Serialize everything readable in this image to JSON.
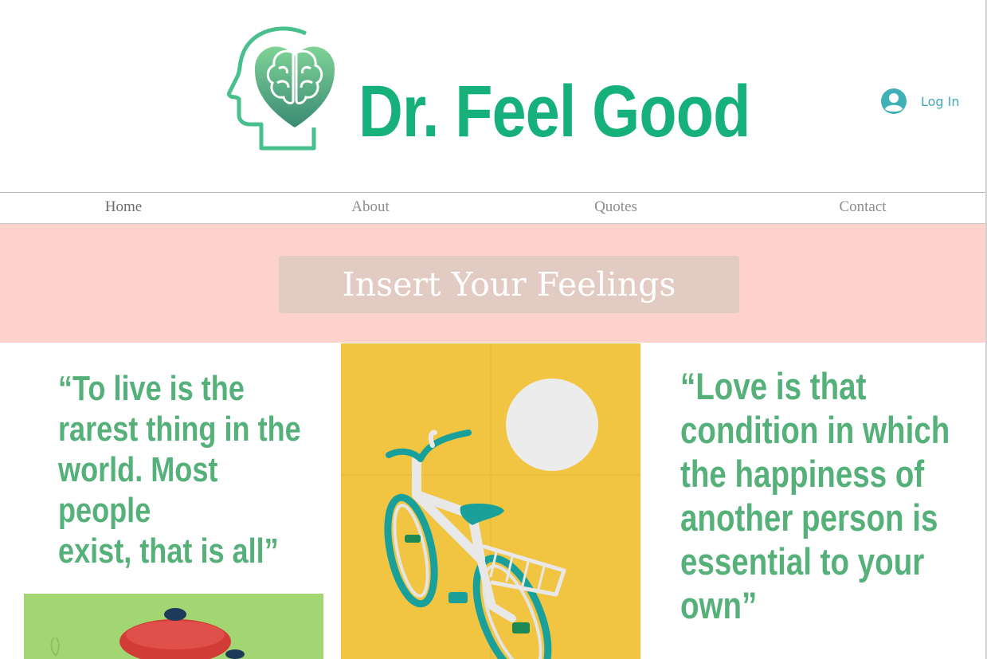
{
  "brand": {
    "name": "Dr. Feel Good",
    "logo_icon": "head-heart-brain-icon",
    "accent_color": "#16b07a"
  },
  "header": {
    "login_label": "Log In",
    "login_icon": "user-avatar-icon"
  },
  "nav": {
    "items": [
      {
        "label": "Home",
        "active": true
      },
      {
        "label": "About",
        "active": false
      },
      {
        "label": "Quotes",
        "active": false
      },
      {
        "label": "Contact",
        "active": false
      }
    ]
  },
  "banner": {
    "button_label": "Insert Your Feelings",
    "background_color": "#fdd2cc",
    "button_color": "#e2cbc3"
  },
  "quotes": {
    "left_lines": [
      "“To live is the",
      "rarest thing in the",
      "world. Most people",
      "exist, that is all”"
    ],
    "right_lines": [
      "“Love is that",
      "condition in which",
      "the happiness of",
      "another person is",
      "essential to your",
      "own”"
    ],
    "text_color": "#55b07a"
  },
  "images": {
    "bike": "bicycle-poster-image",
    "pot": "red-pot-poster-image"
  }
}
